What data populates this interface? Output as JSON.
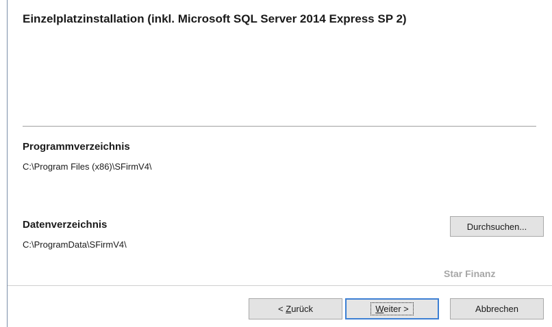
{
  "dialog": {
    "title": "Einzelplatzinstallation (inkl. Microsoft SQL Server 2014 Express SP 2)",
    "program_dir": {
      "label": "Programmverzeichnis",
      "value": "C:\\Program Files (x86)\\SFirmV4\\"
    },
    "data_dir": {
      "label": "Datenverzeichnis",
      "value": "C:\\ProgramData\\SFirmV4\\",
      "browse_label": "Durchsuchen..."
    },
    "brand": "Star Finanz"
  },
  "buttons": {
    "back_prefix": "< ",
    "back_mnemonic": "Z",
    "back_rest": "urück",
    "next_mnemonic": "W",
    "next_rest": "eiter >",
    "cancel": "Abbrechen"
  },
  "colors": {
    "focus_border": "#3c7fd3",
    "button_face": "#e3e3e3",
    "brand_text": "#a6a6a6"
  }
}
